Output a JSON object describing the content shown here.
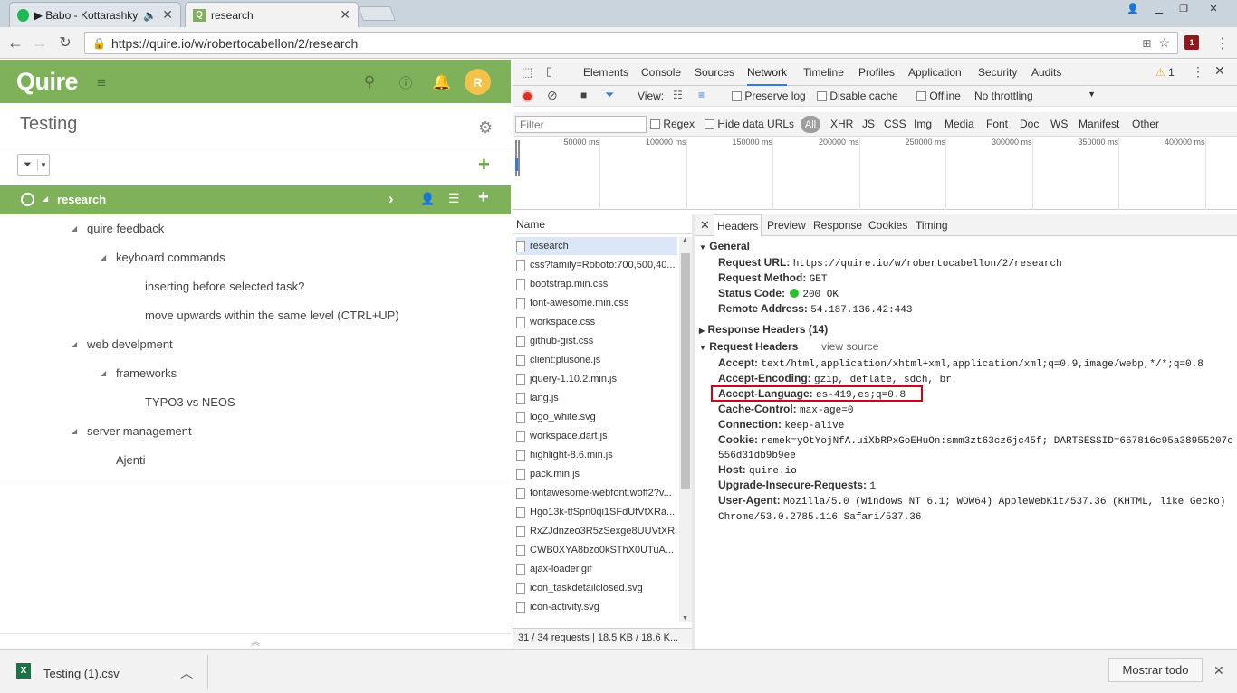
{
  "browser": {
    "tabs": [
      {
        "label": "▶ Babo - Kottarashky"
      },
      {
        "label": "research"
      }
    ],
    "url": "https://quire.io/w/robertocabellon/2/research",
    "extension_badge": "1"
  },
  "quire": {
    "logo": "Quire",
    "avatar_initial": "R",
    "project_title": "Testing",
    "selected_task": "research",
    "tree": [
      {
        "label": "quire feedback",
        "level": 1,
        "expanded": true
      },
      {
        "label": "keyboard commands",
        "level": 2,
        "expanded": true
      },
      {
        "label": "inserting before selected task?",
        "level": 3
      },
      {
        "label": "move upwards within the same level (CTRL+UP)",
        "level": 3
      },
      {
        "label": "web develpment",
        "level": 1,
        "expanded": true
      },
      {
        "label": "frameworks",
        "level": 2,
        "expanded": true
      },
      {
        "label": "TYPO3 vs NEOS",
        "level": 3
      },
      {
        "label": "server management",
        "level": 1,
        "expanded": true
      },
      {
        "label": "Ajenti",
        "level": 2
      }
    ]
  },
  "devtools": {
    "tabs": [
      "Elements",
      "Console",
      "Sources",
      "Network",
      "Timeline",
      "Profiles",
      "Application",
      "Security",
      "Audits"
    ],
    "active_tab": "Network",
    "warning_count": "1",
    "view_label": "View:",
    "preserve_log": "Preserve log",
    "disable_cache": "Disable cache",
    "offline": "Offline",
    "throttling": "No throttling",
    "filter_placeholder": "Filter",
    "regex": "Regex",
    "hide_data_urls": "Hide data URLs",
    "types": [
      "All",
      "XHR",
      "JS",
      "CSS",
      "Img",
      "Media",
      "Font",
      "Doc",
      "WS",
      "Manifest",
      "Other"
    ],
    "timeline_ticks": [
      "50000 ms",
      "100000 ms",
      "150000 ms",
      "200000 ms",
      "250000 ms",
      "300000 ms",
      "350000 ms",
      "400000 ms"
    ],
    "name_header": "Name",
    "requests": [
      "research",
      "css?family=Roboto:700,500,40...",
      "bootstrap.min.css",
      "font-awesome.min.css",
      "workspace.css",
      "github-gist.css",
      "client:plusone.js",
      "jquery-1.10.2.min.js",
      "lang.js",
      "logo_white.svg",
      "workspace.dart.js",
      "highlight-8.6.min.js",
      "pack.min.js",
      "fontawesome-webfont.woff2?v...",
      "Hgo13k-tfSpn0qi1SFdUfVtXRa...",
      "RxZJdnzeo3R5zSexge8UUVtXR...",
      "CWB0XYA8bzo0kSThX0UTuA...",
      "ajax-loader.gif",
      "icon_taskdetailclosed.svg",
      "icon-activity.svg"
    ],
    "status": "31 / 34 requests  |  18.5 KB / 18.6 K...",
    "detail_tabs": [
      "Headers",
      "Preview",
      "Response",
      "Cookies",
      "Timing"
    ],
    "general_title": "General",
    "general": [
      {
        "k": "Request URL:",
        "v": "https://quire.io/w/robertocabellon/2/research"
      },
      {
        "k": "Request Method:",
        "v": "GET"
      },
      {
        "k": "Status Code:",
        "v": "200 OK"
      },
      {
        "k": "Remote Address:",
        "v": "54.187.136.42:443"
      }
    ],
    "response_headers_title": "Response Headers (14)",
    "request_headers_title": "Request Headers",
    "view_source": "view source",
    "request_headers": [
      {
        "k": "Accept:",
        "v": "text/html,application/xhtml+xml,application/xml;q=0.9,image/webp,*/*;q=0.8"
      },
      {
        "k": "Accept-Encoding:",
        "v": "gzip, deflate, sdch, br"
      },
      {
        "k": "Accept-Language:",
        "v": "es-419,es;q=0.8"
      },
      {
        "k": "Cache-Control:",
        "v": "max-age=0"
      },
      {
        "k": "Connection:",
        "v": "keep-alive"
      },
      {
        "k": "Cookie:",
        "v": "remek=yOtYojNfA.uiXbRPxGoEHuOn:smm3zt63cz6jc45f; DARTSESSID=667816c95a38955207c"
      },
      {
        "k": "",
        "v": "556d31db9b9ee"
      },
      {
        "k": "Host:",
        "v": "quire.io"
      },
      {
        "k": "Upgrade-Insecure-Requests:",
        "v": "1"
      },
      {
        "k": "User-Agent:",
        "v": "Mozilla/5.0 (Windows NT 6.1; WOW64) AppleWebKit/537.36 (KHTML, like Gecko)"
      },
      {
        "k": "",
        "v": " Chrome/53.0.2785.116 Safari/537.36"
      }
    ]
  },
  "downloads": {
    "file": "Testing (1).csv",
    "show_all": "Mostrar todo"
  },
  "colors": {
    "quire_green": "#7fb05a",
    "highlight_box": "#d0021b",
    "status_ok": "#2dbd2d"
  }
}
